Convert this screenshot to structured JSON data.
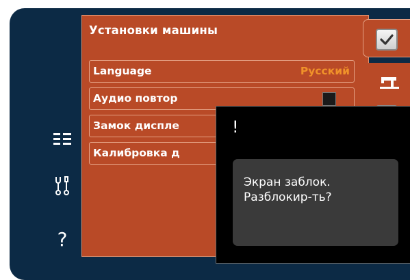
{
  "sidebar": {
    "menu_icon": "list-menu-icon",
    "tools_icon": "tools-icon",
    "help_label": "?"
  },
  "settings_panel": {
    "title": "Установки машины",
    "rows": [
      {
        "label": "Language",
        "value": "Русский"
      },
      {
        "label": "Аудио повтор"
      },
      {
        "label": "Замок диспле"
      },
      {
        "label": "Калибровка д"
      }
    ]
  },
  "right_tabs": {
    "confirm_icon": "checkmark-icon",
    "machine_icon": "sewing-machine-icon",
    "confirm_icon_2": "checkmark-icon"
  },
  "dialog": {
    "mark": "!",
    "message": "Экран заблок.\nРазблокир-ть?"
  },
  "colors": {
    "background": "#0c2a45",
    "panel": "#b94a27",
    "value_accent": "#f0922a",
    "dialog": "#000000",
    "dialog_box": "#3a3a3a"
  }
}
